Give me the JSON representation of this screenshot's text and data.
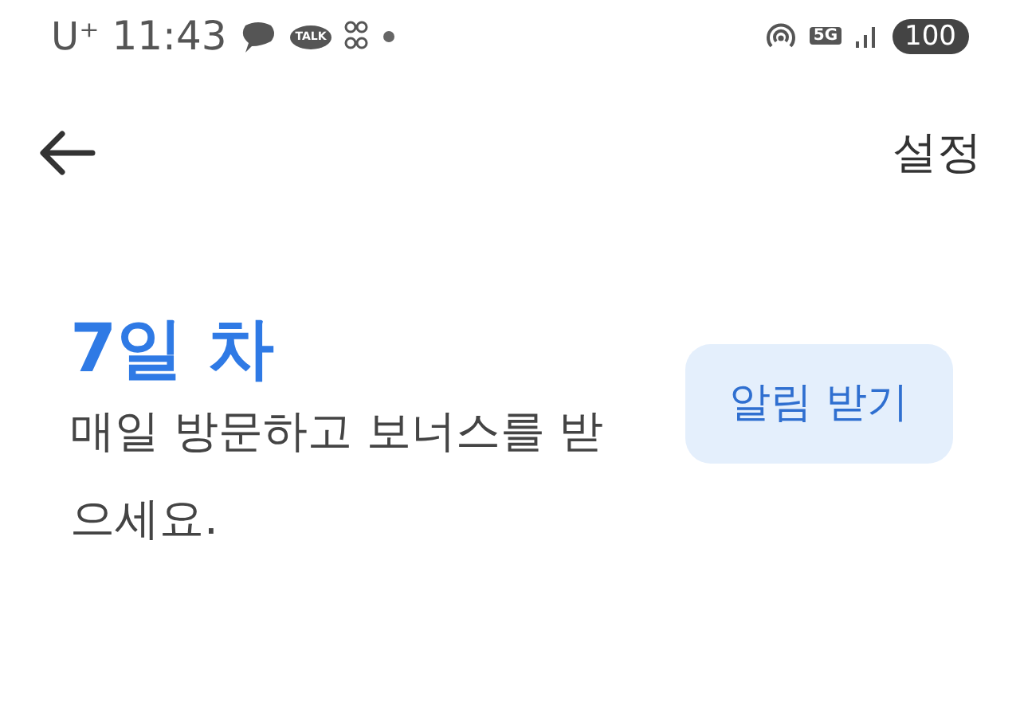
{
  "status_bar": {
    "carrier": "U⁺",
    "time": "11:43",
    "talk_badge": "TALK",
    "network": "5G",
    "battery": "100"
  },
  "header": {
    "action": "설정"
  },
  "streak": {
    "title": "7일 차",
    "description": "매일 방문하고 보너스를 받으세요.",
    "button": "알림 받기"
  }
}
